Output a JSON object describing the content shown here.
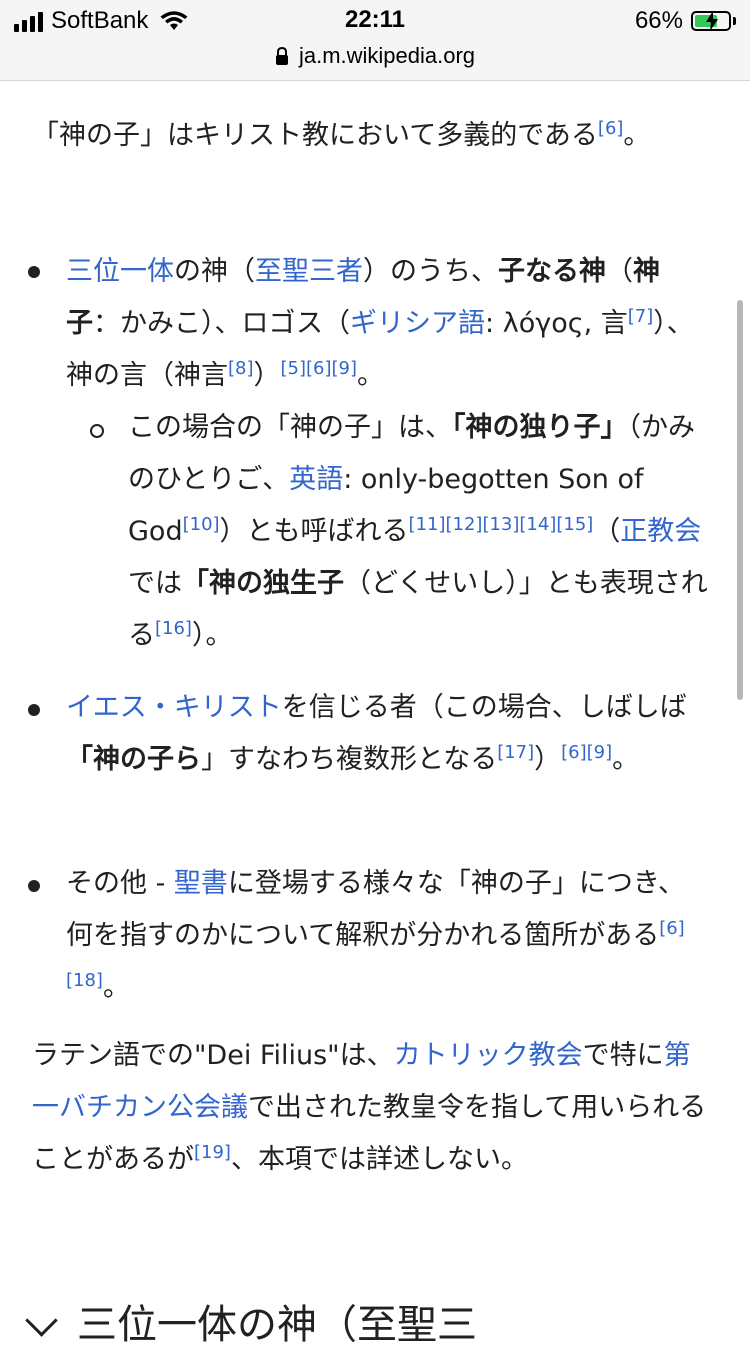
{
  "status": {
    "carrier": "SoftBank",
    "time": "22:11",
    "battery_percent": "66%",
    "url": "ja.m.wikipedia.org"
  },
  "article": {
    "intro": {
      "text": "「神の子」はキリスト教において多義的である",
      "ref": "[6]",
      "end": "。"
    },
    "bullets": [
      {
        "link1": "三位一体",
        "t1": "の神（",
        "link2": "至聖三者",
        "t2": "）のうち、",
        "bold1": "子なる神",
        "t3": "（",
        "bold2": "神子",
        "t4": "：かみこ）、ロゴス（",
        "link3": "ギリシア語",
        "t5": ": λόγος, 言",
        "ref1": "[7]",
        "t6": "）、神の言（神言",
        "ref2": "[8]",
        "t7": "）",
        "ref3": "[5][6][9]",
        "t8": "。",
        "sub": {
          "t1": "この場合の「神の子」は、",
          "bold1": "「神の独り子」",
          "t2": "（かみのひとりご、",
          "link1": "英語",
          "t3": ": only-begotten Son of God",
          "ref1": "[10]",
          "t4": "）とも呼ばれる",
          "ref2": "[11][12][13][14][15]",
          "t5": "（",
          "link2": "正教会",
          "t6": "では",
          "bold2": "「神の独生子",
          "t7": "（どくせいし）」とも表現される",
          "ref3": "[16]",
          "t8": "）。"
        }
      },
      {
        "link1": "イエス・キリスト",
        "t1": "を信じる者（この場合、しばしば",
        "bold1": "「神の子ら",
        "t2": "」すなわち複数形となる",
        "ref1": "[17]",
        "t3": "）",
        "ref2": "[6][9]",
        "t4": "。"
      },
      {
        "t1": "その他 - ",
        "link1": "聖書",
        "t2": "に登場する様々な「神の子」につき、何を指すのかについて解釈が分かれる箇所がある",
        "ref1": "[6][18]",
        "t3": "。"
      }
    ],
    "latin": {
      "t1": "ラテン語での\"Dei Filius\"は、",
      "link1": "カトリック教会",
      "t2": "で特に",
      "link2": "第一バチカン公会議",
      "t3": "で出された教皇令を指して用いられることがあるが",
      "ref1": "[19]",
      "t4": "、本項では詳述しない。"
    },
    "section_heading": "三位一体の神（至聖三"
  },
  "icons": [
    "signal-icon",
    "wifi-icon",
    "battery-icon",
    "lock-icon",
    "chevron-down-icon"
  ]
}
